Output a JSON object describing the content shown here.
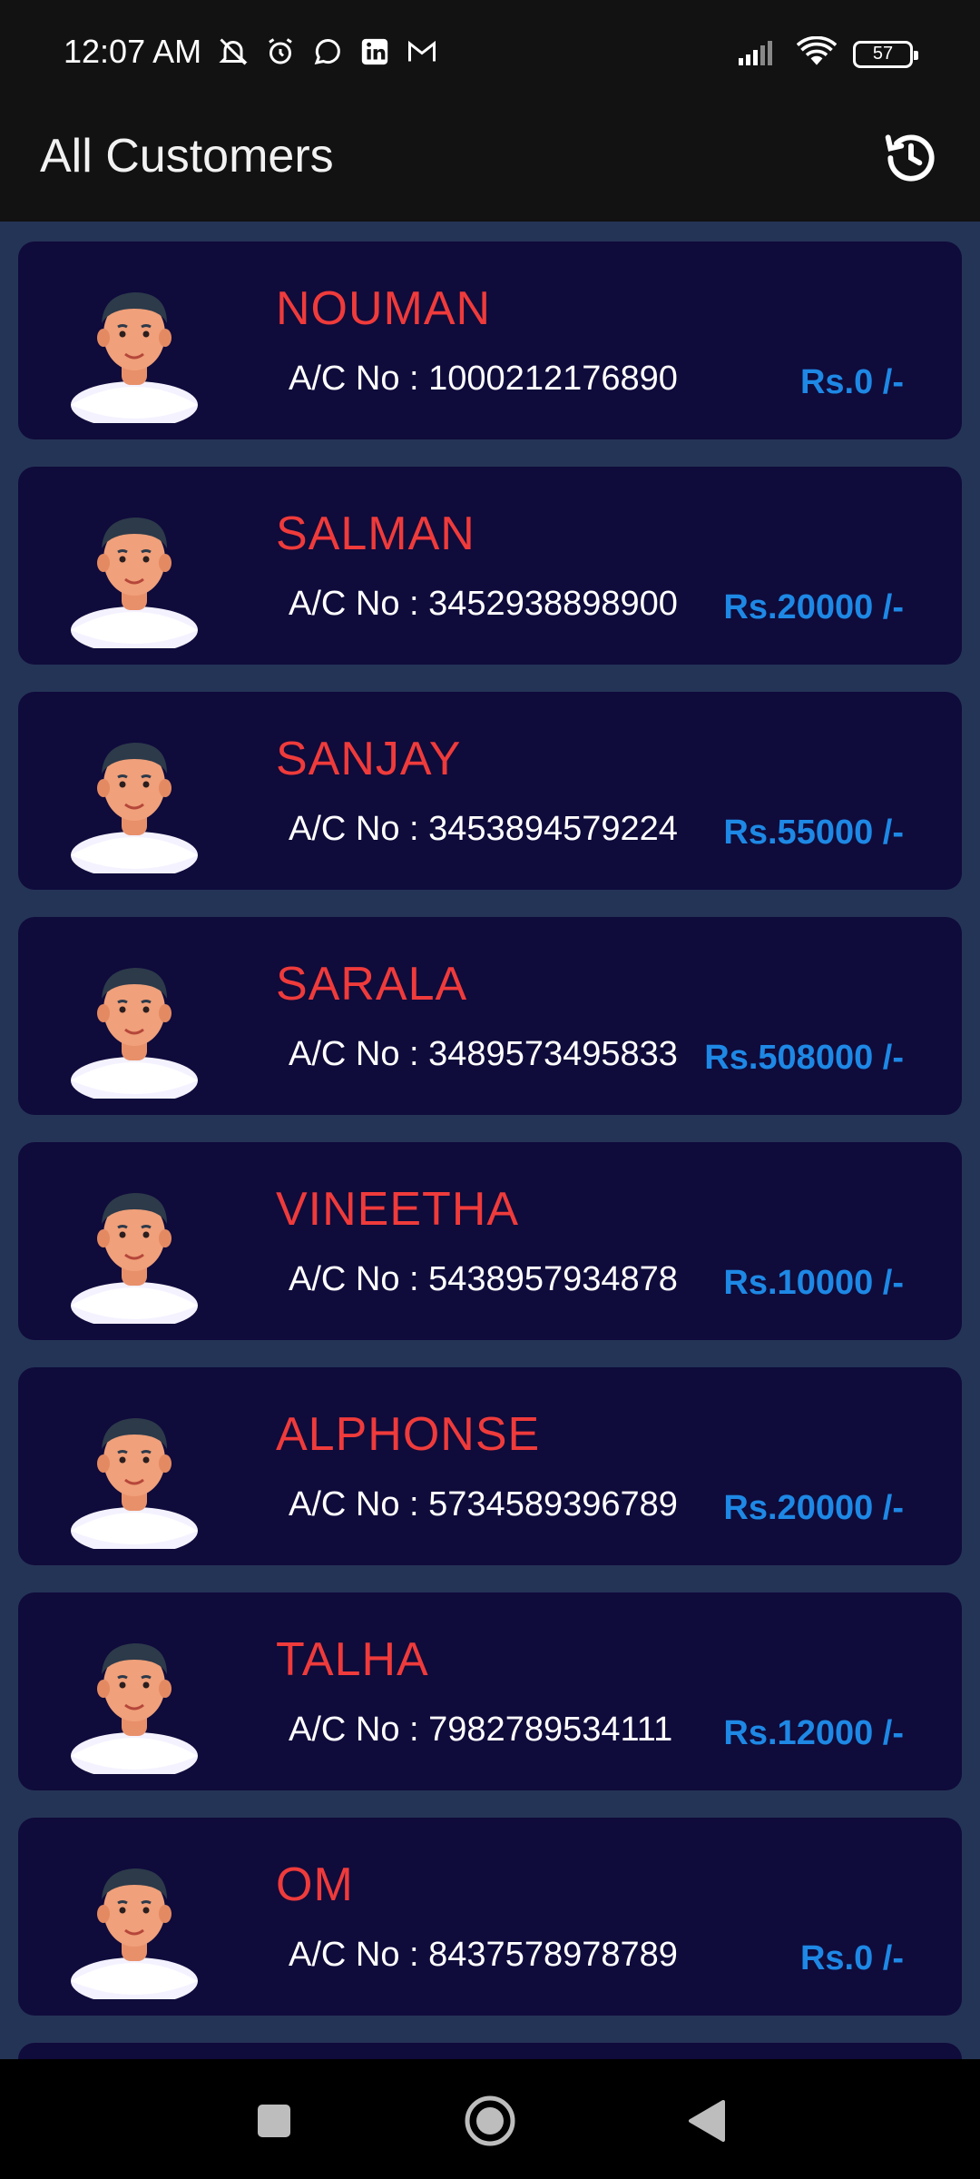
{
  "status": {
    "time": "12:07 AM",
    "battery": "57",
    "left_icons": [
      "mute-icon",
      "alarm-icon",
      "whatsapp-icon",
      "linkedin-icon",
      "gmail-icon"
    ],
    "right_icons": [
      "signal-icon",
      "wifi-icon",
      "battery-icon"
    ]
  },
  "app_bar": {
    "title": "All Customers",
    "history_icon": "history-icon"
  },
  "colors": {
    "name": "#ef3b3b",
    "amount": "#1e88e5",
    "card": "#0f0b3b",
    "background": "#243456"
  },
  "customers": [
    {
      "name": "NOUMAN",
      "acc_label": "A/C No : ",
      "acc_no": "1000212176890",
      "amount": "Rs.0 /-"
    },
    {
      "name": "SALMAN",
      "acc_label": "A/C No : ",
      "acc_no": "3452938898900",
      "amount": "Rs.20000 /-"
    },
    {
      "name": "SANJAY",
      "acc_label": "A/C No : ",
      "acc_no": "3453894579224",
      "amount": "Rs.55000 /-"
    },
    {
      "name": "SARALA",
      "acc_label": "A/C No : ",
      "acc_no": "3489573495833",
      "amount": "Rs.508000 /-"
    },
    {
      "name": "VINEETHA",
      "acc_label": "A/C No : ",
      "acc_no": "5438957934878",
      "amount": "Rs.10000 /-"
    },
    {
      "name": "ALPHONSE",
      "acc_label": "A/C No : ",
      "acc_no": "5734589396789",
      "amount": "Rs.20000 /-"
    },
    {
      "name": "TALHA",
      "acc_label": "A/C No : ",
      "acc_no": "7982789534111",
      "amount": "Rs.12000 /-"
    },
    {
      "name": "OM",
      "acc_label": "A/C No : ",
      "acc_no": "8437578978789",
      "amount": "Rs.0 /-"
    }
  ],
  "nav": [
    "recents-button",
    "home-button",
    "back-button"
  ]
}
